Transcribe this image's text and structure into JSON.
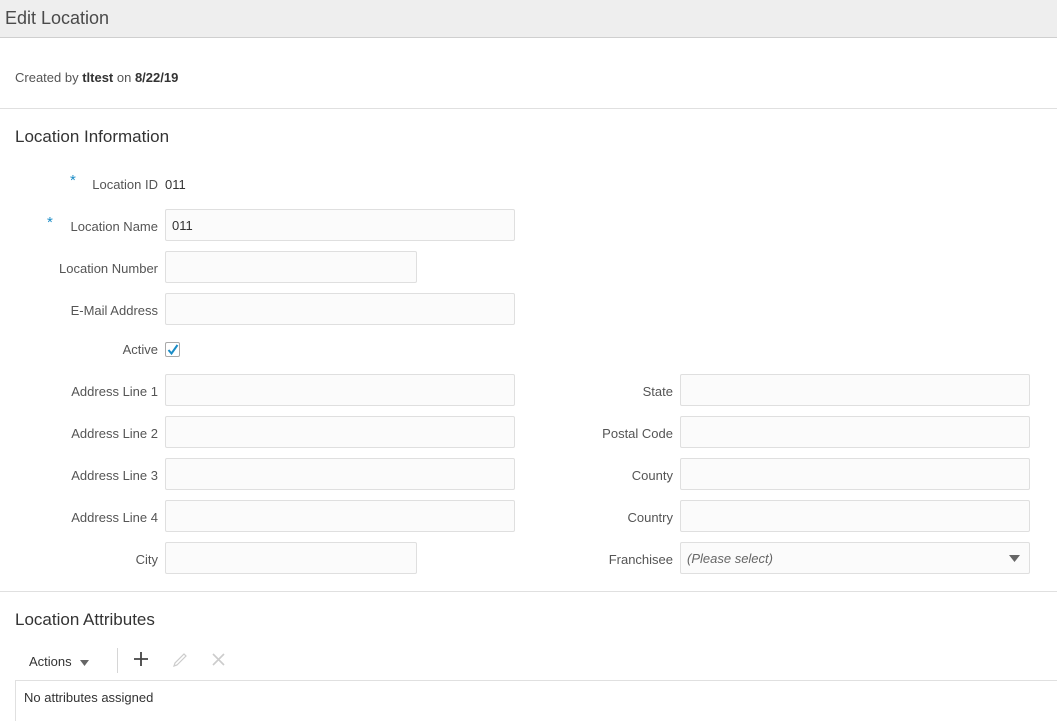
{
  "header": {
    "title": "Edit Location"
  },
  "meta": {
    "created_prefix": "Created by ",
    "created_user": "tltest",
    "created_mid": " on ",
    "created_date": "8/22/19"
  },
  "location_info": {
    "title": "Location Information",
    "required_marker": "*",
    "location_id": {
      "label": "Location ID",
      "value": "011"
    },
    "location_name": {
      "label": "Location Name",
      "value": "011"
    },
    "location_number": {
      "label": "Location Number",
      "value": ""
    },
    "email": {
      "label": "E-Mail Address",
      "value": ""
    },
    "active": {
      "label": "Active",
      "checked": true
    },
    "address1": {
      "label": "Address Line 1",
      "value": ""
    },
    "address2": {
      "label": "Address Line 2",
      "value": ""
    },
    "address3": {
      "label": "Address Line 3",
      "value": ""
    },
    "address4": {
      "label": "Address Line 4",
      "value": ""
    },
    "city": {
      "label": "City",
      "value": ""
    },
    "state": {
      "label": "State",
      "value": ""
    },
    "postal_code": {
      "label": "Postal Code",
      "value": ""
    },
    "county": {
      "label": "County",
      "value": ""
    },
    "country": {
      "label": "Country",
      "value": ""
    },
    "franchisee": {
      "label": "Franchisee",
      "placeholder": "(Please select)"
    }
  },
  "attributes": {
    "title": "Location Attributes",
    "actions_label": "Actions",
    "empty_text": "No attributes assigned",
    "icons": {
      "actions_dropdown": "caret-down-icon",
      "add": "plus-icon",
      "edit": "pencil-icon",
      "delete": "close-icon"
    }
  },
  "colors": {
    "accent": "#1a8cc6",
    "titlebar_bg": "#eeeeee",
    "input_border": "#dfdfdf"
  }
}
